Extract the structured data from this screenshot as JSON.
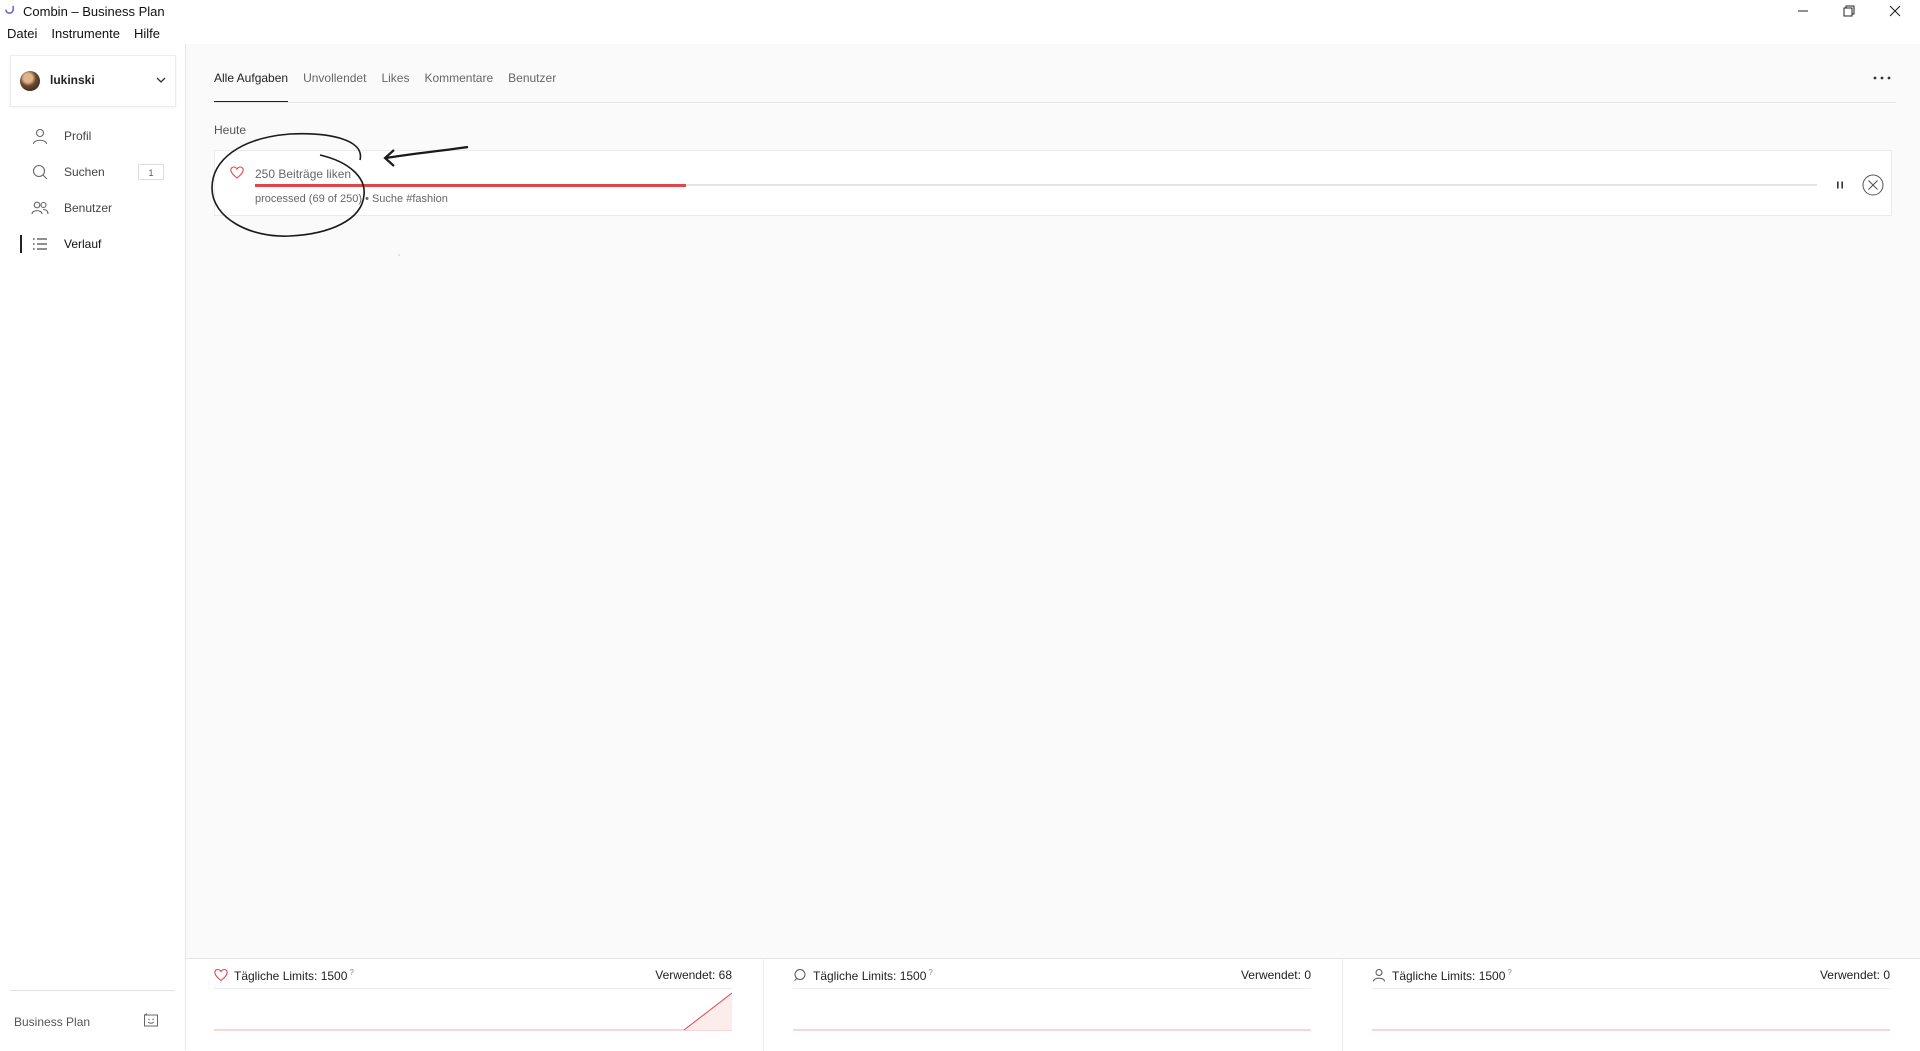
{
  "window": {
    "title": "Combin – Business Plan"
  },
  "menu": [
    "Datei",
    "Instrumente",
    "Hilfe"
  ],
  "account": {
    "name": "lukinski"
  },
  "nav": [
    {
      "label": "Profil",
      "icon": "user-icon"
    },
    {
      "label": "Suchen",
      "icon": "search-icon",
      "badge": "1"
    },
    {
      "label": "Benutzer",
      "icon": "users-icon"
    },
    {
      "label": "Verlauf",
      "icon": "list-icon",
      "active": true
    }
  ],
  "footer": {
    "plan": "Business Plan"
  },
  "tabs": [
    "Alle Aufgaben",
    "Unvollendet",
    "Likes",
    "Kommentare",
    "Benutzer"
  ],
  "section": "Heute",
  "task": {
    "title": "250 Beiträge liken",
    "status": "processed (69 of 250) • Suche #fashion",
    "done": 69,
    "total": 250
  },
  "stats": [
    {
      "icon": "heart-icon",
      "label": "Tägliche Limits: 1500",
      "q": "?",
      "used": "Verwendet: 68",
      "value": 68,
      "limit": 1500
    },
    {
      "icon": "search-icon",
      "label": "Tägliche Limits: 1500",
      "q": "?",
      "used": "Verwendet: 0",
      "value": 0,
      "limit": 1500
    },
    {
      "icon": "user-icon",
      "label": "Tägliche Limits: 1500",
      "q": "?",
      "used": "Verwendet: 0",
      "value": 0,
      "limit": 1500
    }
  ],
  "colors": {
    "accent": "#e0454b",
    "divider": "#e6e6e6"
  }
}
